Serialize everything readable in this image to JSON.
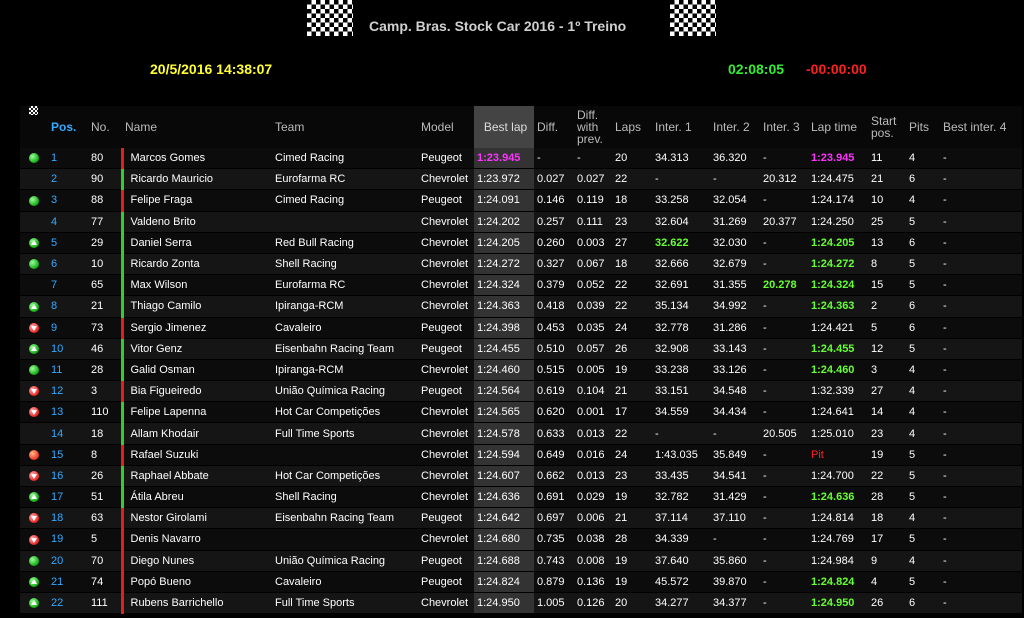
{
  "header": {
    "title": "Camp. Bras. Stock Car 2016 - 1º Treino",
    "datetime": "20/5/2016 14:38:07",
    "session_time": "02:08:05",
    "remaining": "-00:00:00"
  },
  "columns": {
    "icon": "",
    "pos": "Pos.",
    "no": "No.",
    "name": "Name",
    "team": "Team",
    "model": "Model",
    "best": "Best lap",
    "diff": "Diff.",
    "diffprev": "Diff. with prev.",
    "laps": "Laps",
    "i1": "Inter. 1",
    "i2": "Inter. 2",
    "i3": "Inter. 3",
    "lap": "Lap time",
    "start": "Start pos.",
    "pits": "Pits",
    "bi4": "Best inter. 4"
  },
  "colors": {
    "position": "#33aaff",
    "overall_best": "#ff33ff",
    "personal_best": "#66ff33",
    "pit": "#ff2020"
  },
  "rows": [
    {
      "icon": "green-dot-icon",
      "pos": "1",
      "no": "80",
      "bar": "red",
      "name": "Marcos Gomes",
      "team": "Cimed Racing",
      "model": "Peugeot",
      "best": "1:23.945",
      "best_style": "purple",
      "diff": "-",
      "diffprev": "-",
      "laps": "20",
      "i1": "34.313",
      "i1_style": "",
      "i2": "36.320",
      "i3": "-",
      "i3_style": "",
      "lap": "1:23.945",
      "lap_style": "purple",
      "start": "11",
      "pits": "4",
      "bi4": "-"
    },
    {
      "icon": "checkered-flag-icon",
      "pos": "2",
      "no": "90",
      "bar": "green",
      "name": "Ricardo Mauricio",
      "team": "Eurofarma RC",
      "model": "Chevrolet",
      "best": "1:23.972",
      "best_style": "",
      "diff": "0.027",
      "diffprev": "0.027",
      "laps": "22",
      "i1": "-",
      "i1_style": "",
      "i2": "-",
      "i3": "20.312",
      "i3_style": "",
      "lap": "1:24.475",
      "lap_style": "",
      "start": "21",
      "pits": "6",
      "bi4": "-"
    },
    {
      "icon": "green-dot-icon",
      "pos": "3",
      "no": "88",
      "bar": "red",
      "name": "Felipe Fraga",
      "team": "Cimed Racing",
      "model": "Peugeot",
      "best": "1:24.091",
      "best_style": "",
      "diff": "0.146",
      "diffprev": "0.119",
      "laps": "18",
      "i1": "33.258",
      "i1_style": "",
      "i2": "32.054",
      "i3": "-",
      "i3_style": "",
      "lap": "1:24.174",
      "lap_style": "",
      "start": "10",
      "pits": "4",
      "bi4": "-"
    },
    {
      "icon": "checkered-flag-icon",
      "pos": "4",
      "no": "77",
      "bar": "green",
      "name": "Valdeno Brito",
      "team": "",
      "model": "Chevrolet",
      "best": "1:24.202",
      "best_style": "",
      "diff": "0.257",
      "diffprev": "0.111",
      "laps": "23",
      "i1": "32.604",
      "i1_style": "",
      "i2": "31.269",
      "i3": "20.377",
      "i3_style": "",
      "lap": "1:24.250",
      "lap_style": "",
      "start": "25",
      "pits": "5",
      "bi4": "-"
    },
    {
      "icon": "green-up-arrow-icon",
      "pos": "5",
      "no": "29",
      "bar": "green",
      "name": "Daniel Serra",
      "team": "Red Bull Racing",
      "model": "Chevrolet",
      "best": "1:24.205",
      "best_style": "",
      "diff": "0.260",
      "diffprev": "0.003",
      "laps": "27",
      "i1": "32.622",
      "i1_style": "green",
      "i2": "32.030",
      "i3": "-",
      "i3_style": "",
      "lap": "1:24.205",
      "lap_style": "green",
      "start": "13",
      "pits": "6",
      "bi4": "-"
    },
    {
      "icon": "green-dot-icon",
      "pos": "6",
      "no": "10",
      "bar": "green",
      "name": "Ricardo Zonta",
      "team": "Shell Racing",
      "model": "Chevrolet",
      "best": "1:24.272",
      "best_style": "",
      "diff": "0.327",
      "diffprev": "0.067",
      "laps": "18",
      "i1": "32.666",
      "i1_style": "",
      "i2": "32.679",
      "i3": "-",
      "i3_style": "",
      "lap": "1:24.272",
      "lap_style": "green",
      "start": "8",
      "pits": "5",
      "bi4": "-"
    },
    {
      "icon": "checkered-flag-icon",
      "pos": "7",
      "no": "65",
      "bar": "green",
      "name": "Max Wilson",
      "team": "Eurofarma RC",
      "model": "Chevrolet",
      "best": "1:24.324",
      "best_style": "",
      "diff": "0.379",
      "diffprev": "0.052",
      "laps": "22",
      "i1": "32.691",
      "i1_style": "",
      "i2": "31.355",
      "i3": "20.278",
      "i3_style": "green",
      "lap": "1:24.324",
      "lap_style": "green",
      "start": "15",
      "pits": "5",
      "bi4": "-"
    },
    {
      "icon": "green-up-arrow-icon",
      "pos": "8",
      "no": "21",
      "bar": "green",
      "name": "Thiago Camilo",
      "team": "Ipiranga-RCM",
      "model": "Chevrolet",
      "best": "1:24.363",
      "best_style": "",
      "diff": "0.418",
      "diffprev": "0.039",
      "laps": "22",
      "i1": "35.134",
      "i1_style": "",
      "i2": "34.992",
      "i3": "-",
      "i3_style": "",
      "lap": "1:24.363",
      "lap_style": "green",
      "start": "2",
      "pits": "6",
      "bi4": "-"
    },
    {
      "icon": "red-down-arrow-icon",
      "pos": "9",
      "no": "73",
      "bar": "red",
      "name": "Sergio Jimenez",
      "team": "Cavaleiro",
      "model": "Peugeot",
      "best": "1:24.398",
      "best_style": "",
      "diff": "0.453",
      "diffprev": "0.035",
      "laps": "24",
      "i1": "32.778",
      "i1_style": "",
      "i2": "31.286",
      "i3": "-",
      "i3_style": "",
      "lap": "1:24.421",
      "lap_style": "",
      "start": "5",
      "pits": "6",
      "bi4": "-"
    },
    {
      "icon": "green-up-arrow-icon",
      "pos": "10",
      "no": "46",
      "bar": "green",
      "name": "Vitor Genz",
      "team": "Eisenbahn Racing Team",
      "model": "Peugeot",
      "best": "1:24.455",
      "best_style": "",
      "diff": "0.510",
      "diffprev": "0.057",
      "laps": "26",
      "i1": "32.908",
      "i1_style": "",
      "i2": "33.143",
      "i3": "-",
      "i3_style": "",
      "lap": "1:24.455",
      "lap_style": "green",
      "start": "12",
      "pits": "5",
      "bi4": "-"
    },
    {
      "icon": "green-dot-icon",
      "pos": "11",
      "no": "28",
      "bar": "green",
      "name": "Galid Osman",
      "team": "Ipiranga-RCM",
      "model": "Chevrolet",
      "best": "1:24.460",
      "best_style": "",
      "diff": "0.515",
      "diffprev": "0.005",
      "laps": "19",
      "i1": "33.238",
      "i1_style": "",
      "i2": "33.126",
      "i3": "-",
      "i3_style": "",
      "lap": "1:24.460",
      "lap_style": "green",
      "start": "3",
      "pits": "4",
      "bi4": "-"
    },
    {
      "icon": "red-down-arrow-icon",
      "pos": "12",
      "no": "3",
      "bar": "red",
      "name": "Bia Figueiredo",
      "team": "União Química Racing",
      "model": "Peugeot",
      "best": "1:24.564",
      "best_style": "",
      "diff": "0.619",
      "diffprev": "0.104",
      "laps": "21",
      "i1": "33.151",
      "i1_style": "",
      "i2": "34.548",
      "i3": "-",
      "i3_style": "",
      "lap": "1:32.339",
      "lap_style": "",
      "start": "27",
      "pits": "4",
      "bi4": "-"
    },
    {
      "icon": "red-down-arrow-icon",
      "pos": "13",
      "no": "110",
      "bar": "green",
      "name": "Felipe Lapenna",
      "team": "Hot Car Competições",
      "model": "Chevrolet",
      "best": "1:24.565",
      "best_style": "",
      "diff": "0.620",
      "diffprev": "0.001",
      "laps": "17",
      "i1": "34.559",
      "i1_style": "",
      "i2": "34.434",
      "i3": "-",
      "i3_style": "",
      "lap": "1:24.641",
      "lap_style": "",
      "start": "14",
      "pits": "4",
      "bi4": "-"
    },
    {
      "icon": "checkered-flag-icon",
      "pos": "14",
      "no": "18",
      "bar": "green",
      "name": "Allam Khodair",
      "team": "Full Time Sports",
      "model": "Chevrolet",
      "best": "1:24.578",
      "best_style": "",
      "diff": "0.633",
      "diffprev": "0.013",
      "laps": "22",
      "i1": "-",
      "i1_style": "",
      "i2": "-",
      "i3": "20.505",
      "i3_style": "",
      "lap": "1:25.010",
      "lap_style": "",
      "start": "23",
      "pits": "4",
      "bi4": "-"
    },
    {
      "icon": "red-dot-icon",
      "pos": "15",
      "no": "8",
      "bar": "red",
      "name": "Rafael Suzuki",
      "team": "",
      "model": "Chevrolet",
      "best": "1:24.594",
      "best_style": "",
      "diff": "0.649",
      "diffprev": "0.016",
      "laps": "24",
      "i1": "1:43.035",
      "i1_style": "",
      "i2": "35.849",
      "i3": "-",
      "i3_style": "",
      "lap": "Pit",
      "lap_style": "pit",
      "start": "19",
      "pits": "5",
      "bi4": "-"
    },
    {
      "icon": "red-down-arrow-icon",
      "pos": "16",
      "no": "26",
      "bar": "green",
      "name": "Raphael Abbate",
      "team": "Hot Car Competições",
      "model": "Chevrolet",
      "best": "1:24.607",
      "best_style": "",
      "diff": "0.662",
      "diffprev": "0.013",
      "laps": "23",
      "i1": "33.435",
      "i1_style": "",
      "i2": "34.541",
      "i3": "-",
      "i3_style": "",
      "lap": "1:24.700",
      "lap_style": "",
      "start": "22",
      "pits": "5",
      "bi4": "-"
    },
    {
      "icon": "green-up-arrow-icon",
      "pos": "17",
      "no": "51",
      "bar": "green",
      "name": "Átila Abreu",
      "team": "Shell Racing",
      "model": "Chevrolet",
      "best": "1:24.636",
      "best_style": "",
      "diff": "0.691",
      "diffprev": "0.029",
      "laps": "19",
      "i1": "32.782",
      "i1_style": "",
      "i2": "31.429",
      "i3": "-",
      "i3_style": "",
      "lap": "1:24.636",
      "lap_style": "green",
      "start": "28",
      "pits": "5",
      "bi4": "-"
    },
    {
      "icon": "red-down-arrow-icon",
      "pos": "18",
      "no": "63",
      "bar": "red",
      "name": "Nestor Girolami",
      "team": "Eisenbahn Racing Team",
      "model": "Peugeot",
      "best": "1:24.642",
      "best_style": "",
      "diff": "0.697",
      "diffprev": "0.006",
      "laps": "21",
      "i1": "37.114",
      "i1_style": "",
      "i2": "37.110",
      "i3": "-",
      "i3_style": "",
      "lap": "1:24.814",
      "lap_style": "",
      "start": "18",
      "pits": "4",
      "bi4": "-"
    },
    {
      "icon": "red-down-arrow-icon",
      "pos": "19",
      "no": "5",
      "bar": "red",
      "name": "Denis Navarro",
      "team": "",
      "model": "Chevrolet",
      "best": "1:24.680",
      "best_style": "",
      "diff": "0.735",
      "diffprev": "0.038",
      "laps": "28",
      "i1": "34.339",
      "i1_style": "",
      "i2": "-",
      "i3": "-",
      "i3_style": "",
      "lap": "1:24.769",
      "lap_style": "",
      "start": "17",
      "pits": "5",
      "bi4": "-"
    },
    {
      "icon": "green-dot-icon",
      "pos": "20",
      "no": "70",
      "bar": "red",
      "name": "Diego Nunes",
      "team": "União Química Racing",
      "model": "Peugeot",
      "best": "1:24.688",
      "best_style": "",
      "diff": "0.743",
      "diffprev": "0.008",
      "laps": "19",
      "i1": "37.640",
      "i1_style": "",
      "i2": "35.860",
      "i3": "-",
      "i3_style": "",
      "lap": "1:24.984",
      "lap_style": "",
      "start": "9",
      "pits": "4",
      "bi4": "-"
    },
    {
      "icon": "green-up-arrow-icon",
      "pos": "21",
      "no": "74",
      "bar": "red",
      "name": "Popó Bueno",
      "team": "Cavaleiro",
      "model": "Peugeot",
      "best": "1:24.824",
      "best_style": "",
      "diff": "0.879",
      "diffprev": "0.136",
      "laps": "19",
      "i1": "45.572",
      "i1_style": "",
      "i2": "39.870",
      "i3": "-",
      "i3_style": "",
      "lap": "1:24.824",
      "lap_style": "green",
      "start": "4",
      "pits": "5",
      "bi4": "-"
    },
    {
      "icon": "green-up-arrow-icon",
      "pos": "22",
      "no": "111",
      "bar": "red",
      "name": "Rubens Barrichello",
      "team": "Full Time Sports",
      "model": "Chevrolet",
      "best": "1:24.950",
      "best_style": "",
      "diff": "1.005",
      "diffprev": "0.126",
      "laps": "20",
      "i1": "34.277",
      "i1_style": "",
      "i2": "34.377",
      "i3": "-",
      "i3_style": "",
      "lap": "1:24.950",
      "lap_style": "green",
      "start": "26",
      "pits": "6",
      "bi4": "-"
    }
  ]
}
